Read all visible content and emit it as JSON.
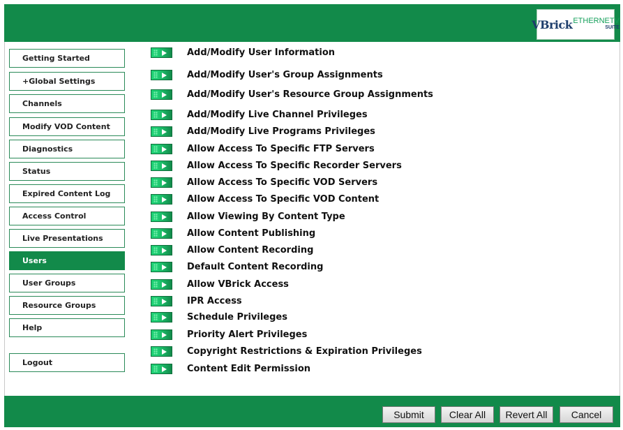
{
  "header": {
    "logo": {
      "brand": "VBrick",
      "product": "ETHERNETV",
      "suite": "SUITE"
    }
  },
  "sidebar": {
    "items": [
      {
        "label": "Getting Started",
        "active": false
      },
      {
        "label": "+Global Settings",
        "active": false
      },
      {
        "label": "Channels",
        "active": false
      },
      {
        "label": "Modify VOD Content",
        "active": false
      },
      {
        "label": "Diagnostics",
        "active": false
      },
      {
        "label": "Status",
        "active": false
      },
      {
        "label": "Expired Content Log",
        "active": false
      },
      {
        "label": "Access Control",
        "active": false
      },
      {
        "label": "Live Presentations",
        "active": false
      },
      {
        "label": "Users",
        "active": true
      },
      {
        "label": "User Groups",
        "active": false
      },
      {
        "label": "Resource Groups",
        "active": false
      },
      {
        "label": "Help",
        "active": false
      }
    ],
    "logout": "Logout"
  },
  "links": [
    "Add/Modify User Information",
    "Add/Modify User's Group Assignments",
    "Add/Modify User's Resource Group Assignments",
    "Add/Modify Live Channel Privileges",
    "Add/Modify Live Programs Privileges",
    "Allow Access To Specific FTP Servers",
    "Allow Access To Specific Recorder Servers",
    "Allow Access To Specific VOD Servers",
    "Allow Access To Specific VOD Content",
    "Allow Viewing By Content Type",
    "Allow Content Publishing",
    "Allow Content Recording",
    "Default Content Recording",
    "Allow VBrick Access",
    "IPR Access",
    "Schedule Privileges",
    "Priority Alert Privileges",
    "Copyright Restrictions & Expiration Privileges",
    "Content Edit Permission"
  ],
  "footer": {
    "submit": "Submit",
    "clear_all": "Clear All",
    "revert_all": "Revert All",
    "cancel": "Cancel"
  },
  "colors": {
    "brand_green": "#128a4a",
    "arrow_green": "#1fcf74"
  }
}
